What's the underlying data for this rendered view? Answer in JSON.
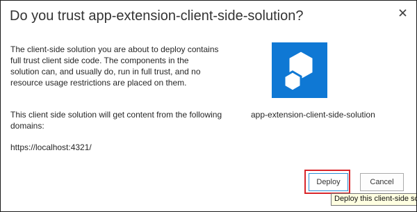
{
  "dialog": {
    "title": "Do you trust app-extension-client-side-solution?",
    "close_icon": "close-icon",
    "message": "The client-side solution you are about to deploy contains full trust client side code. The components in the solution can, and usually do, run in full trust, and no resource usage restrictions are placed on them.",
    "domains_message": "This client side solution will get content from the following domains:",
    "domain": "https://localhost:4321/",
    "app_name": "app-extension-client-side-solution",
    "app_icon": "app-package-icon",
    "app_icon_color": "#0f78d4",
    "buttons": {
      "deploy": "Deploy",
      "cancel": "Cancel"
    },
    "highlight_color": "#d9252a",
    "tooltip": "Deploy this client-side solution"
  }
}
